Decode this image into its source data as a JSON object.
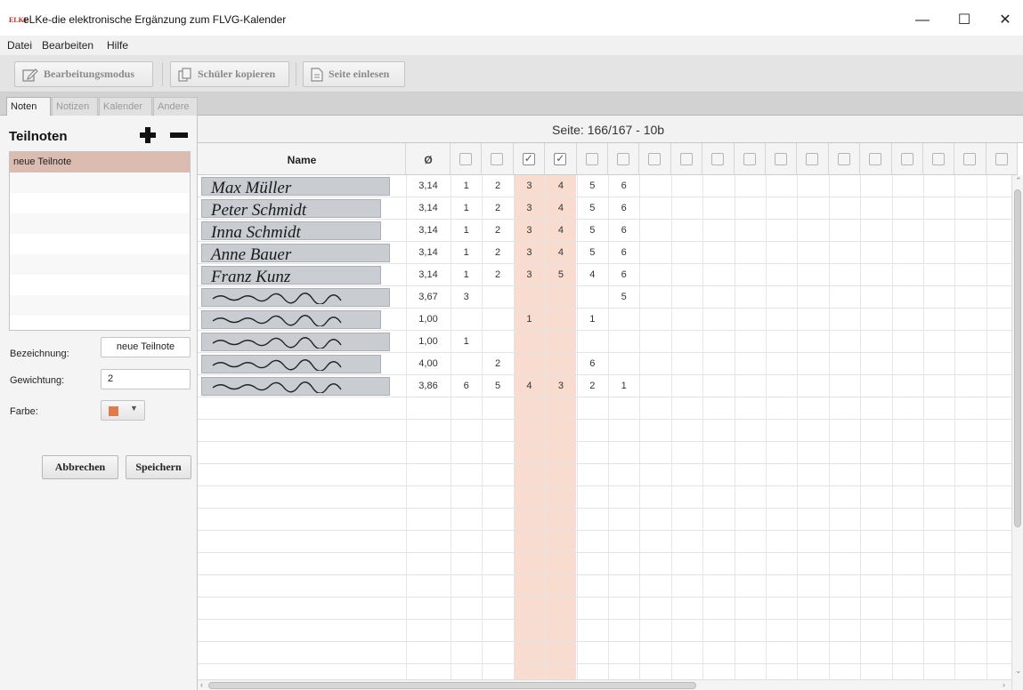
{
  "window": {
    "logo": "ELKE",
    "title": "eLKe-die elektronische Ergänzung zum FLVG-Kalender",
    "minimize": "—",
    "maximize": "☐",
    "close": "✕"
  },
  "menu": [
    "Datei",
    "Bearbeiten",
    "Hilfe"
  ],
  "toolbar": {
    "edit_mode": "Bearbeitungsmodus",
    "copy_students": "Schüler kopieren",
    "read_page": "Seite einlesen"
  },
  "tabs": [
    "Noten",
    "Notizen",
    "Kalender",
    "Andere"
  ],
  "active_tab": "Noten",
  "left_panel": {
    "title": "Teilnoten",
    "add_icon": "plus-icon",
    "remove_icon": "minus-icon",
    "items": [
      "neue Teilnote"
    ],
    "selected_item": "neue Teilnote",
    "bezeichnung_label": "Bezeichnung:",
    "bezeichnung_value": "neue Teilnote",
    "gewichtung_label": "Gewichtung:",
    "gewichtung_value": "2",
    "farbe_label": "Farbe:",
    "farbe_color": "#e07b4f",
    "cancel": "Abbrechen",
    "save": "Speichern"
  },
  "main": {
    "page_label": "Seite: 166/167 - 10b",
    "col_name": "Name",
    "col_avg": "Ø",
    "grade_column_checked": [
      false,
      false,
      true,
      true,
      false,
      false,
      false,
      false,
      false,
      false,
      false,
      false,
      false,
      false,
      false,
      false,
      false,
      false
    ],
    "highlight_color": "#f8dccf",
    "rows": [
      {
        "name": "Max Müller",
        "avg": "3,14",
        "grades": [
          "1",
          "2",
          "3",
          "4",
          "5",
          "6"
        ]
      },
      {
        "name": "Peter Schmidt",
        "avg": "3,14",
        "grades": [
          "1",
          "2",
          "3",
          "4",
          "5",
          "6"
        ]
      },
      {
        "name": "Inna Schmidt",
        "avg": "3,14",
        "grades": [
          "1",
          "2",
          "3",
          "4",
          "5",
          "6"
        ]
      },
      {
        "name": "Anne Bauer",
        "avg": "3,14",
        "grades": [
          "1",
          "2",
          "3",
          "4",
          "5",
          "6"
        ]
      },
      {
        "name": "Franz Kunz",
        "avg": "3,14",
        "grades": [
          "1",
          "2",
          "3",
          "5",
          "4",
          "6"
        ]
      },
      {
        "name": "",
        "avg": "3,67",
        "grades": [
          "3",
          "",
          "",
          "",
          "",
          "5"
        ]
      },
      {
        "name": "",
        "avg": "1,00",
        "grades": [
          "",
          "",
          "1",
          "",
          "1",
          ""
        ]
      },
      {
        "name": "",
        "avg": "1,00",
        "grades": [
          "1",
          "",
          "",
          "",
          "",
          ""
        ]
      },
      {
        "name": "",
        "avg": "4,00",
        "grades": [
          "",
          "2",
          "",
          "",
          "6",
          ""
        ]
      },
      {
        "name": "",
        "avg": "3,86",
        "grades": [
          "6",
          "5",
          "4",
          "3",
          "2",
          "1"
        ]
      }
    ],
    "empty_rows": 13
  }
}
